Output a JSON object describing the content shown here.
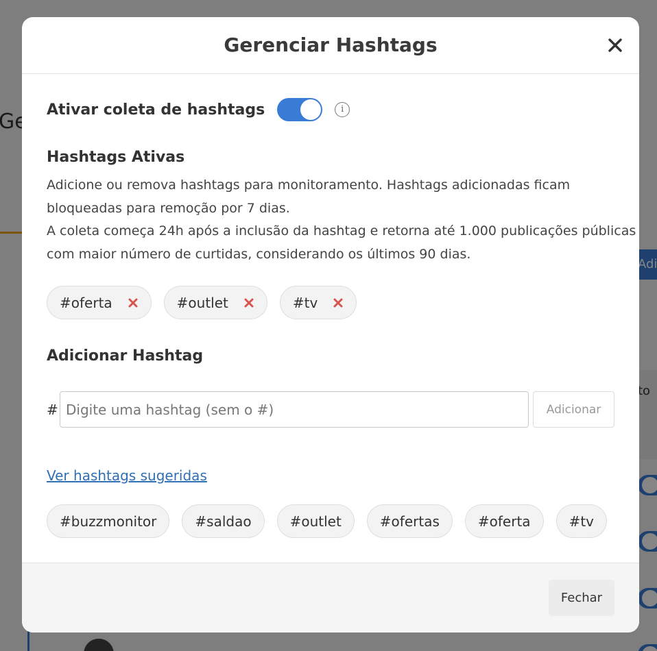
{
  "background": {
    "title_fragment": "Ge",
    "button_fragment": "Adi",
    "panel_fragment": "to"
  },
  "modal": {
    "title": "Gerenciar Hashtags",
    "close_icon": "close-icon",
    "toggle": {
      "label": "Ativar coleta de hashtags",
      "enabled": true,
      "info_glyph": "i"
    },
    "active": {
      "title": "Hashtags Ativas",
      "description": [
        "Adicione ou remova hashtags para monitoramento. Hashtags adicionadas ficam",
        "bloqueadas para remoção por 7 dias.",
        "A coleta começa 24h após a inclusão da hashtag e retorna até 1.000 publicações públicas",
        "com maior número de curtidas, considerando os últimos 90 dias."
      ],
      "tags": [
        "#oferta",
        "#outlet",
        "#tv"
      ]
    },
    "add": {
      "title": "Adicionar Hashtag",
      "prefix": "#",
      "placeholder": "Digite uma hashtag (sem o #)",
      "value": "",
      "button_label": "Adicionar"
    },
    "suggestions": {
      "link_label": "Ver hashtags sugeridas",
      "tags": [
        "#buzzmonitor",
        "#saldao",
        "#outlet",
        "#ofertas",
        "#oferta",
        "#tv"
      ]
    },
    "footer": {
      "close_label": "Fechar"
    }
  },
  "colors": {
    "accent": "#3a7bd5",
    "remove": "#d9534f",
    "link": "#2f6fb3"
  }
}
